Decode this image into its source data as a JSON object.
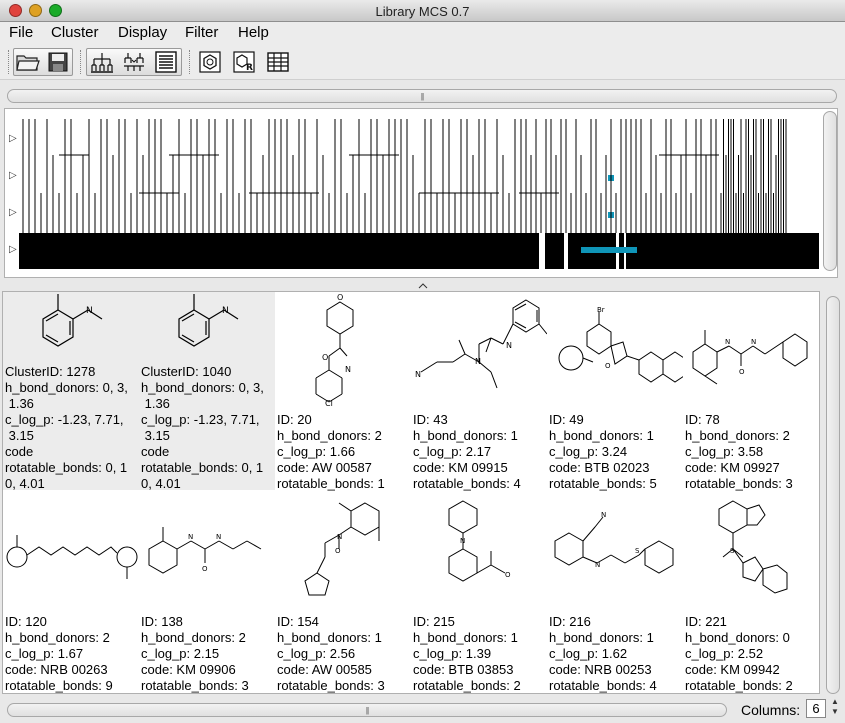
{
  "window": {
    "title": "Library MCS 0.7",
    "traffic_lights": {
      "close": "#e0443e",
      "minimize": "#dea123",
      "zoom": "#1aab29"
    }
  },
  "menubar": {
    "items": [
      "File",
      "Cluster",
      "Display",
      "Filter",
      "Help"
    ]
  },
  "toolbar": {
    "icons": [
      "open-folder-icon",
      "save-icon",
      "tree-layout-icon",
      "tree-collapse-icon",
      "list-view-icon",
      "molecule-icon",
      "r-group-icon",
      "table-icon"
    ]
  },
  "colors": {
    "selection_accent": "#0f95b8",
    "cluster_bg": "#ececec"
  },
  "grid": {
    "row1": [
      {
        "lines": [
          "ClusterID: 1278",
          "h_bond_donors: 0, 3,",
          " 1.36",
          "c_log_p: -1.23, 7.71,",
          " 3.15",
          "code",
          "rotatable_bonds: 0, 1",
          "0, 4.01"
        ],
        "cluster": true
      },
      {
        "lines": [
          "ClusterID: 1040",
          "h_bond_donors: 0, 3,",
          " 1.36",
          "c_log_p: -1.23, 7.71,",
          " 3.15",
          "code",
          "rotatable_bonds: 0, 1",
          "0, 4.01"
        ],
        "cluster": true
      },
      {
        "lines": [
          "ID: 20",
          "h_bond_donors: 2",
          "c_log_p: 1.66",
          "code: AW 00587",
          "rotatable_bonds: 1"
        ]
      },
      {
        "lines": [
          "ID: 43",
          "h_bond_donors: 1",
          "c_log_p: 2.17",
          "code: KM 09915",
          "rotatable_bonds: 4"
        ]
      },
      {
        "lines": [
          "ID: 49",
          "h_bond_donors: 1",
          "c_log_p: 3.24",
          "code: BTB 02023",
          "rotatable_bonds: 5"
        ]
      },
      {
        "lines": [
          "ID: 78",
          "h_bond_donors: 2",
          "c_log_p: 3.58",
          "code: KM 09927",
          "rotatable_bonds: 3"
        ]
      }
    ],
    "row2": [
      {
        "lines": [
          "ID: 120",
          "h_bond_donors: 2",
          "c_log_p: 1.67",
          "code: NRB 00263",
          "rotatable_bonds: 9"
        ]
      },
      {
        "lines": [
          "ID: 138",
          "h_bond_donors: 2",
          "c_log_p: 2.15",
          "code: KM 09906",
          "rotatable_bonds: 3"
        ]
      },
      {
        "lines": [
          "ID: 154",
          "h_bond_donors: 1",
          "c_log_p: 2.56",
          "code: AW 00585",
          "rotatable_bonds: 3"
        ]
      },
      {
        "lines": [
          "ID: 215",
          "h_bond_donors: 1",
          "c_log_p: 1.39",
          "code: BTB 03853",
          "rotatable_bonds: 2"
        ]
      },
      {
        "lines": [
          "ID: 216",
          "h_bond_donors: 1",
          "c_log_p: 1.62",
          "code: NRB 00253",
          "rotatable_bonds: 4"
        ]
      },
      {
        "lines": [
          "ID: 221",
          "h_bond_donors: 0",
          "c_log_p: 2.52",
          "code: KM 09942",
          "rotatable_bonds: 2"
        ]
      }
    ]
  },
  "footer": {
    "columns_label": "Columns:",
    "columns_value": "6"
  }
}
